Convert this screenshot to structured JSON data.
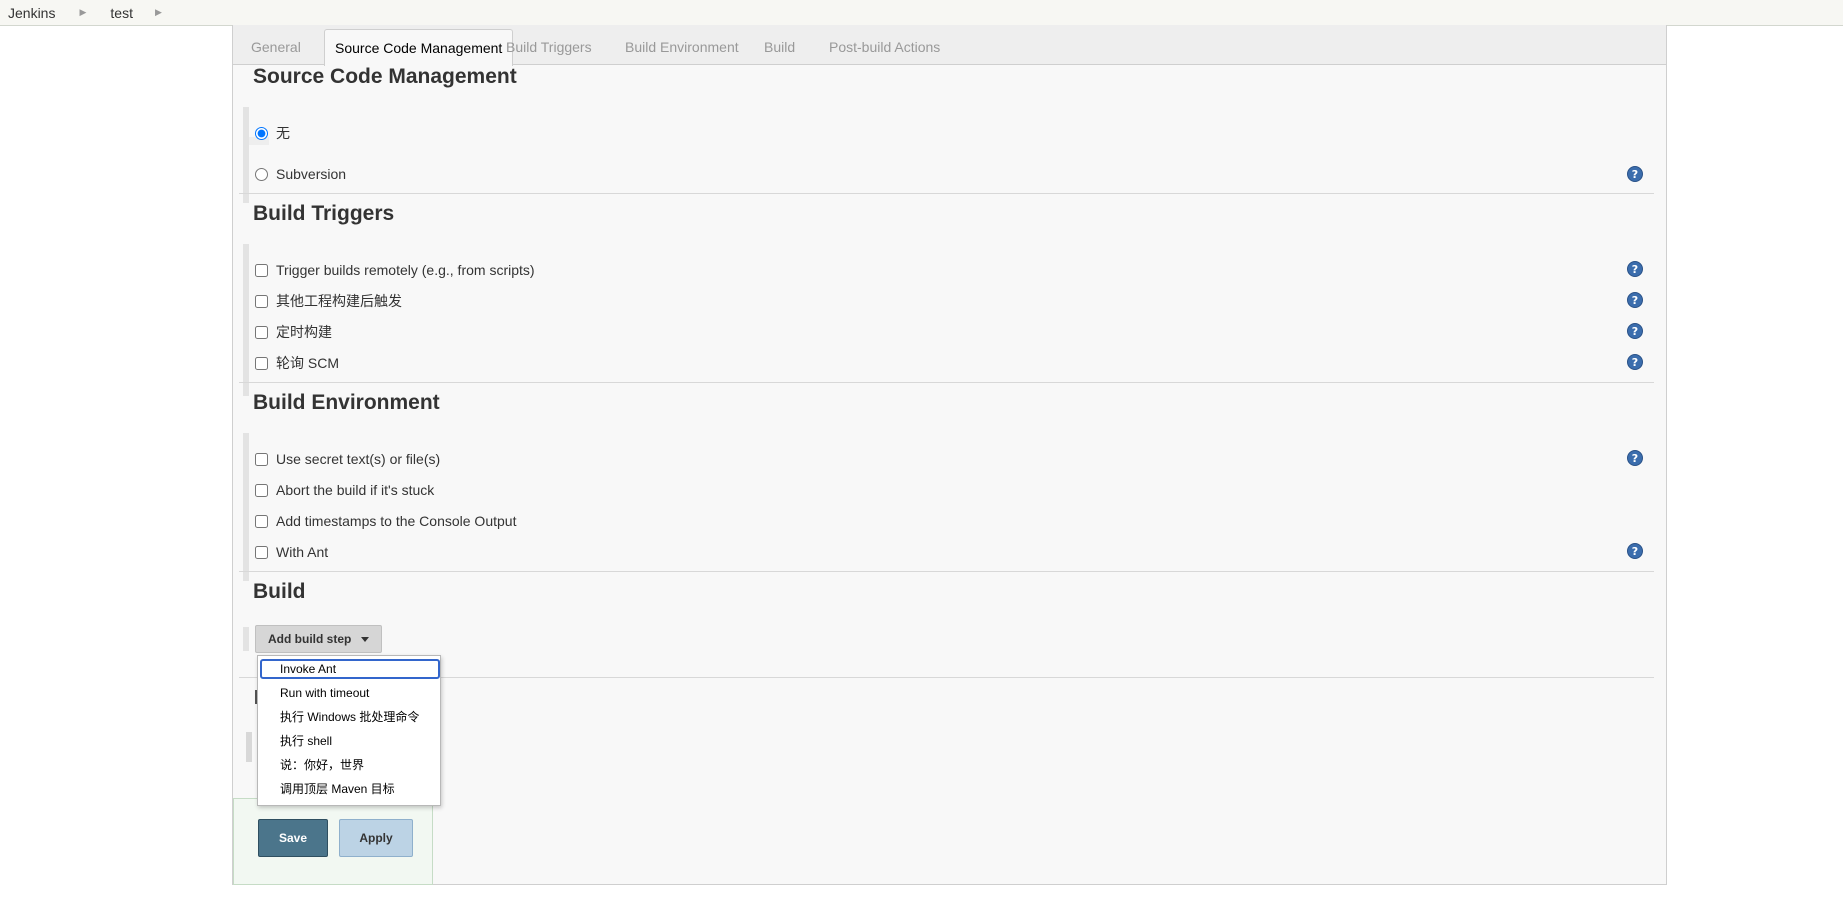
{
  "breadcrumb": {
    "root": "Jenkins",
    "job": "test"
  },
  "tabs": [
    {
      "label": "General",
      "active": false
    },
    {
      "label": "Source Code Management",
      "active": true
    },
    {
      "label": "Build Triggers",
      "active": false
    },
    {
      "label": "Build Environment",
      "active": false
    },
    {
      "label": "Build",
      "active": false
    },
    {
      "label": "Post-build Actions",
      "active": false
    }
  ],
  "scm": {
    "title": "Source Code Management",
    "options": [
      {
        "label": "无",
        "checked": true
      },
      {
        "label": "Subversion",
        "checked": false
      }
    ]
  },
  "triggers": {
    "title": "Build Triggers",
    "options": [
      {
        "label": "Trigger builds remotely (e.g., from scripts)",
        "checked": false
      },
      {
        "label": "其他工程构建后触发",
        "checked": false
      },
      {
        "label": "定时构建",
        "checked": false
      },
      {
        "label": "轮询 SCM",
        "checked": false
      }
    ]
  },
  "environment": {
    "title": "Build Environment",
    "options": [
      {
        "label": "Use secret text(s) or file(s)",
        "checked": false
      },
      {
        "label": "Abort the build if it's stuck",
        "checked": false
      },
      {
        "label": "Add timestamps to the Console Output",
        "checked": false
      },
      {
        "label": "With Ant",
        "checked": false
      }
    ]
  },
  "build": {
    "title": "Build",
    "add_step_label": "Add build step",
    "menu": [
      "Invoke Ant",
      "Run with timeout",
      "执行 Windows 批处理命令",
      "执行 shell",
      "说：你好，世界",
      "调用顶层 Maven 目标"
    ]
  },
  "actions": {
    "save_label": "Save",
    "apply_label": "Apply"
  },
  "icons": {
    "help": "help-icon",
    "breadcrumb_separator": "chevron-right-icon",
    "dropdown": "caret-down-icon"
  },
  "colors": {
    "save": "#4b758b",
    "apply": "#bcd3e5",
    "help": "#3b6dad"
  }
}
